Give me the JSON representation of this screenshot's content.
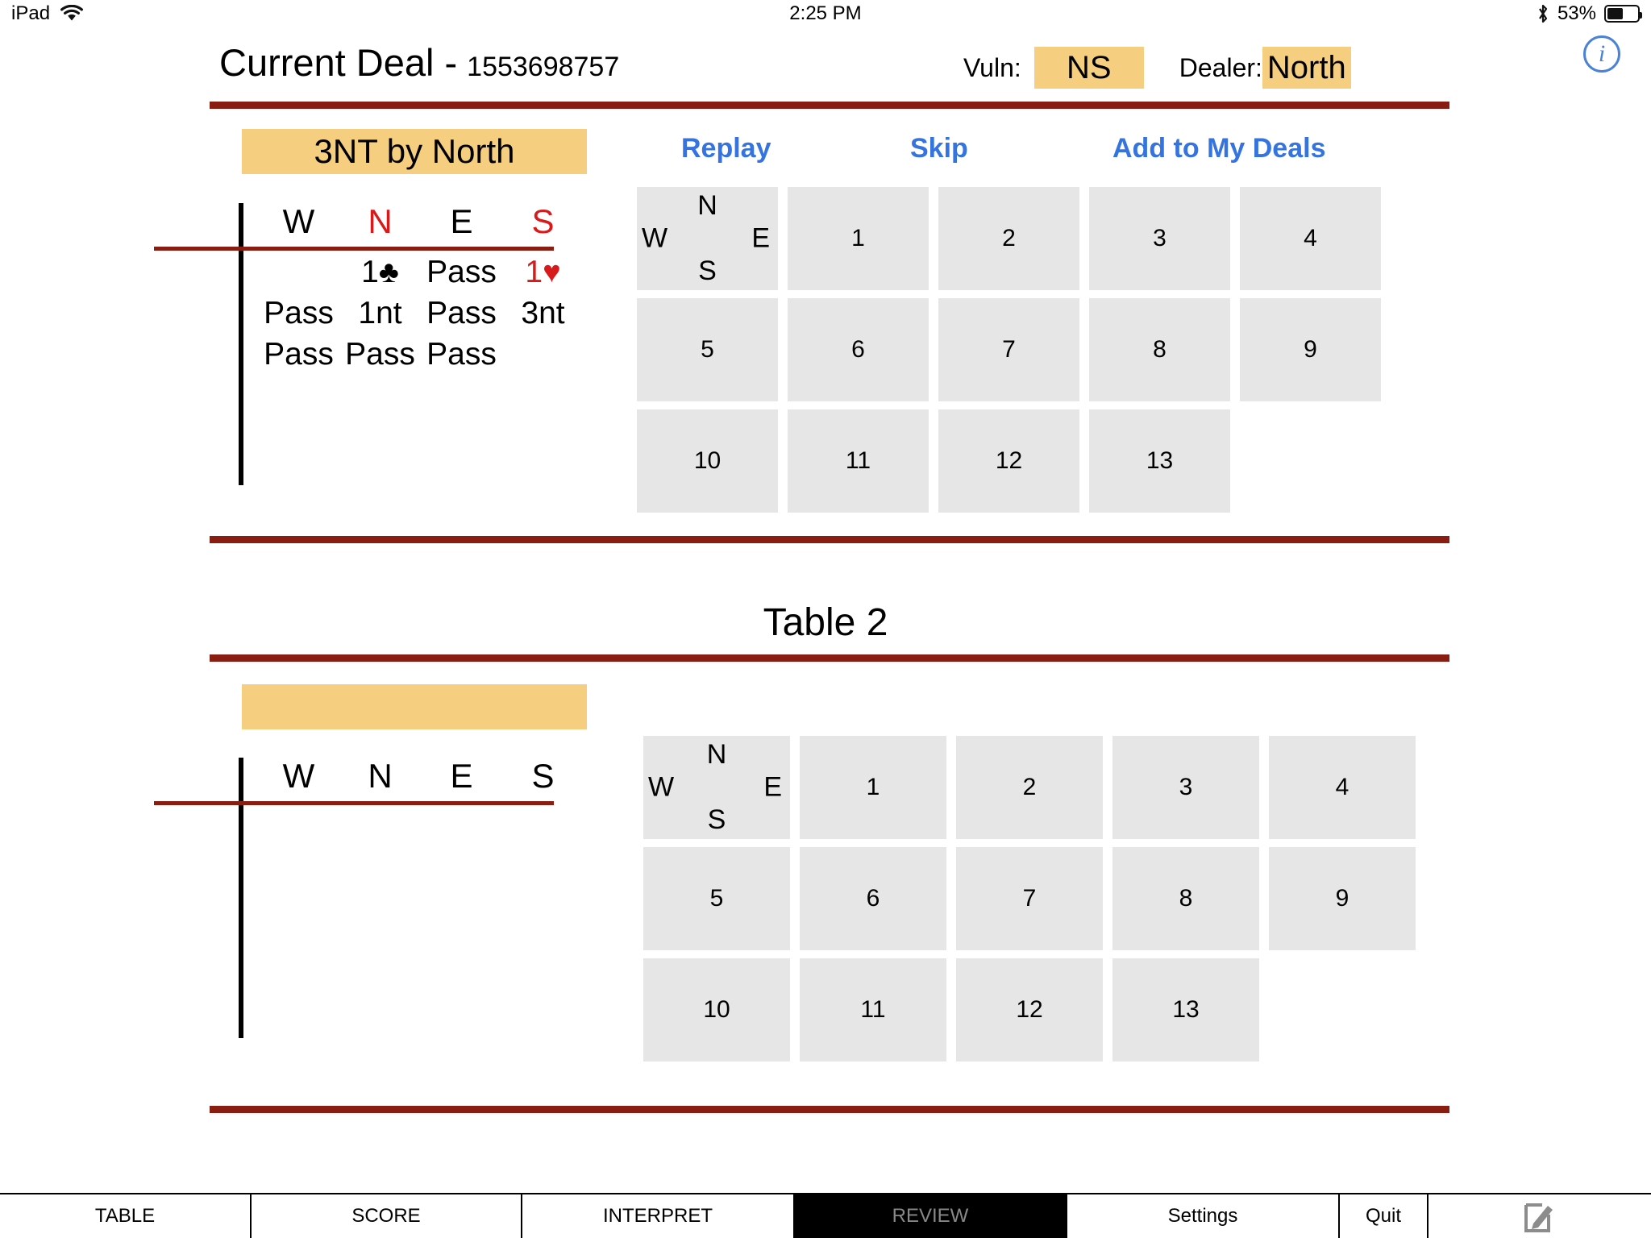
{
  "status_bar": {
    "device": "iPad",
    "wifi_icon": "wifi-icon",
    "time": "2:25 PM",
    "bluetooth_icon": "bluetooth-icon",
    "battery_percent": "53%",
    "battery_icon": "battery-icon"
  },
  "header": {
    "title": "Current Deal -",
    "deal_number": "1553698757",
    "vuln_label": "Vuln:",
    "vuln_value": "NS",
    "dealer_label": "Dealer:",
    "dealer_value": "North",
    "info_icon": "info-icon",
    "info_glyph": "i"
  },
  "colors": {
    "highlight": "#F5CE80",
    "rule": "#8A1D12",
    "link": "#3574E0",
    "cell": "#E6E6E6",
    "red_suit": "#D81A1A"
  },
  "table1": {
    "contract": "3NT by North",
    "actions": [
      {
        "label": "Replay",
        "name": "replay-button"
      },
      {
        "label": "Skip",
        "name": "skip-button"
      },
      {
        "label": "Add to My Deals",
        "name": "add-to-my-deals-button"
      }
    ],
    "bidding": {
      "headers": [
        {
          "text": "W",
          "color": "black"
        },
        {
          "text": "N",
          "color": "red"
        },
        {
          "text": "E",
          "color": "black"
        },
        {
          "text": "S",
          "color": "red"
        }
      ],
      "rows": [
        [
          {
            "text": "",
            "suit": "",
            "color": "black"
          },
          {
            "text": "1",
            "suit": "♣",
            "color": "black"
          },
          {
            "text": "Pass",
            "suit": "",
            "color": "black"
          },
          {
            "text": "1",
            "suit": "♥",
            "color": "red"
          }
        ],
        [
          {
            "text": "Pass",
            "suit": "",
            "color": "black"
          },
          {
            "text": "1nt",
            "suit": "",
            "color": "black"
          },
          {
            "text": "Pass",
            "suit": "",
            "color": "black"
          },
          {
            "text": "3nt",
            "suit": "",
            "color": "black"
          }
        ],
        [
          {
            "text": "Pass",
            "suit": "",
            "color": "black"
          },
          {
            "text": "Pass",
            "suit": "",
            "color": "black"
          },
          {
            "text": "Pass",
            "suit": "",
            "color": "black"
          },
          {
            "text": "",
            "suit": "",
            "color": "black"
          }
        ]
      ]
    },
    "compass": {
      "n": "N",
      "e": "E",
      "s": "S",
      "w": "W"
    },
    "tricks": [
      "1",
      "2",
      "3",
      "4",
      "5",
      "6",
      "7",
      "8",
      "9",
      "10",
      "11",
      "12",
      "13"
    ]
  },
  "table2": {
    "title": "Table 2",
    "contract": "",
    "bidding": {
      "headers": [
        {
          "text": "W",
          "color": "black"
        },
        {
          "text": "N",
          "color": "black"
        },
        {
          "text": "E",
          "color": "black"
        },
        {
          "text": "S",
          "color": "black"
        }
      ],
      "rows": []
    },
    "compass": {
      "n": "N",
      "e": "E",
      "s": "S",
      "w": "W"
    },
    "tricks": [
      "1",
      "2",
      "3",
      "4",
      "5",
      "6",
      "7",
      "8",
      "9",
      "10",
      "11",
      "12",
      "13"
    ]
  },
  "toolbar": {
    "items": [
      {
        "label": "TABLE",
        "name": "tab-table",
        "active": false
      },
      {
        "label": "SCORE",
        "name": "tab-score",
        "active": false
      },
      {
        "label": "INTERPRET",
        "name": "tab-interpret",
        "active": false
      },
      {
        "label": "REVIEW",
        "name": "tab-review",
        "active": true
      },
      {
        "label": "Settings",
        "name": "tab-settings",
        "active": false
      },
      {
        "label": "Quit",
        "name": "tab-quit",
        "active": false
      }
    ],
    "compose_icon": "compose-pencil-icon"
  }
}
